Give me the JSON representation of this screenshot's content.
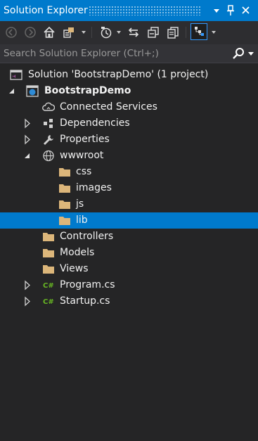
{
  "titlebar": {
    "title": "Solution Explorer",
    "dropdown_icon": "chevron-down-icon",
    "pin_icon": "pin-icon",
    "close_icon": "close-icon"
  },
  "toolbar": {
    "buttons": [
      {
        "icon": "back-arrow-icon"
      },
      {
        "icon": "forward-arrow-icon"
      },
      {
        "icon": "home-icon"
      },
      {
        "icon": "switch-views-icon"
      },
      {
        "icon": "pending-changes-filter-icon"
      },
      {
        "icon": "sync-with-active-document-icon"
      },
      {
        "icon": "collapse-all-icon"
      },
      {
        "icon": "show-all-files-icon"
      },
      {
        "icon": "properties-icon"
      }
    ]
  },
  "search": {
    "placeholder": "Search Solution Explorer (Ctrl+;)",
    "value": ""
  },
  "tree": {
    "solution": {
      "label": "Solution 'BootstrapDemo' (1 project)",
      "icon": "solution-icon"
    },
    "project": {
      "label": "BootstrapDemo",
      "icon": "web-project-icon",
      "expanded": true
    },
    "items": [
      {
        "label": "Connected Services",
        "icon": "cloud-icon"
      },
      {
        "label": "Dependencies",
        "icon": "dependencies-icon",
        "expandable": true
      },
      {
        "label": "Properties",
        "icon": "wrench-icon",
        "expandable": true
      },
      {
        "label": "wwwroot",
        "icon": "globe-icon",
        "expanded": true
      },
      {
        "label": "css",
        "icon": "folder-icon"
      },
      {
        "label": "images",
        "icon": "folder-icon"
      },
      {
        "label": "js",
        "icon": "folder-icon"
      },
      {
        "label": "lib",
        "icon": "folder-icon",
        "selected": true
      },
      {
        "label": "Controllers",
        "icon": "folder-icon"
      },
      {
        "label": "Models",
        "icon": "folder-icon"
      },
      {
        "label": "Views",
        "icon": "folder-icon"
      },
      {
        "label": "Program.cs",
        "icon": "csharp-file-icon",
        "expandable": true
      },
      {
        "label": "Startup.cs",
        "icon": "csharp-file-icon",
        "expandable": true
      }
    ]
  },
  "colors": {
    "accent": "#007acc",
    "background": "#252526",
    "folder": "#dcb67a",
    "csharp": "#68b723"
  }
}
